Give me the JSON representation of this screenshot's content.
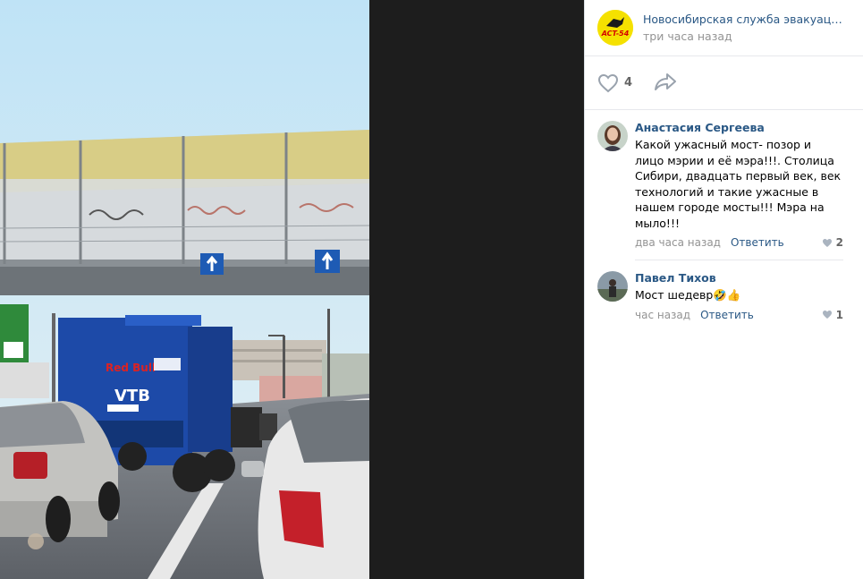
{
  "post": {
    "author": "Новосибирская служба эвакуации...",
    "time": "три часа назад",
    "logo_text": "ACT-54",
    "likes": "4"
  },
  "photo": {
    "truck_brand": "Red Bull",
    "truck_text": "VTB"
  },
  "comments": [
    {
      "author": "Анастасия Сергеева",
      "text": "Какой ужасный мост- позор и лицо мэрии и её мэра!!!. Столица Сибири, двадцать первый век, век технологий и такие ужасные в нашем городе мосты!!! Мэра на мыло!!!",
      "time": "два часа назад",
      "reply_label": "Ответить",
      "likes": "2"
    },
    {
      "author": "Павел Тихов",
      "text": "Мост шедевр🤣👍",
      "time": "час назад",
      "reply_label": "Ответить",
      "likes": "1"
    }
  ],
  "colors": {
    "link": "#2a5885",
    "muted": "#939393",
    "logo_bg": "#f5e100",
    "backdrop": "#1d1d1d"
  },
  "icons": [
    "heart-icon",
    "share-arrow-icon",
    "small-heart-icon"
  ]
}
